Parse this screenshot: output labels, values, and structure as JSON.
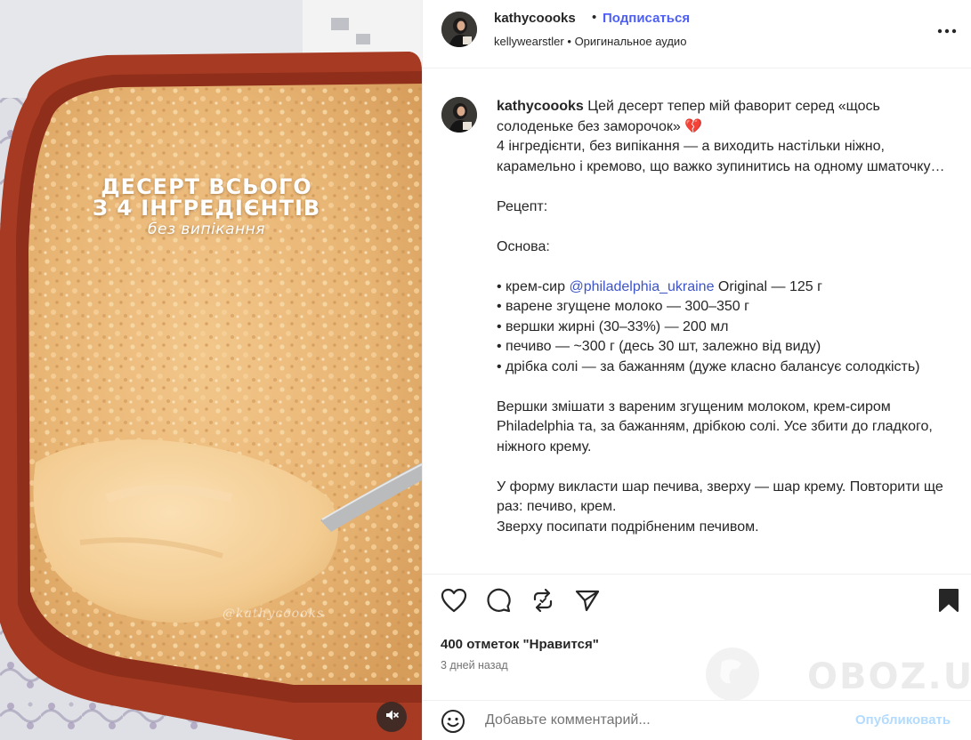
{
  "post": {
    "media": {
      "overlay_line1": "ДЕСЕРТ ВСЬОГО",
      "overlay_line2": "З 4 ІНГРЕДІЄНТІВ",
      "overlay_sub": "без випікання",
      "watermark": "@kathycoooks",
      "mute_icon": "speaker-muted-icon"
    },
    "header": {
      "username": "kathycoooks",
      "separator": "•",
      "follow_label": "Подписаться",
      "audio_user": "kellywearstler",
      "audio_separator": "•",
      "audio_label": "Оригинальное аудио",
      "more_icon": "more-options-icon"
    },
    "caption": {
      "username": "kathycoooks",
      "first_line": "Цей десерт тепер мій фаворит серед «щось солоденьке без заморочок» 💔",
      "lines": [
        "4 інгредієнти, без випікання — а виходить настільки ніжно, карамельно і кремово, що важко зупинитись на одному шматочку…",
        "",
        "Рецепт:",
        "",
        "Основа:",
        ""
      ],
      "ingredient_mention_prefix": "• крем-сир ",
      "ingredient_mention": "@philadelphia_ukraine",
      "ingredient_mention_suffix": " Original — 125 г",
      "ingredients": [
        "• варене згущене молоко — 300–350 г",
        "• вершки жирні (30–33%) — 200 мл",
        "• печиво — ~300 г (десь 30 шт, залежно від виду)",
        "• дрібка солі — за бажанням (дуже класно балансує солодкість)"
      ],
      "steps": [
        "",
        "Вершки змішати з вареним згущеним молоком, крем-сиром Philadelphia та, за бажанням, дрібкою солі. Усе збити до гладкого, ніжного крему.",
        "",
        "У форму викласти шар печива, зверху — шар крему. Повторити ще раз: печиво, крем.",
        "Зверху посипати подрібненим печивом."
      ]
    },
    "actions": {
      "like_icon": "heart-icon",
      "comment_icon": "comment-bubble-icon",
      "repost_icon": "repost-icon",
      "share_icon": "paper-plane-icon",
      "save_icon": "bookmark-filled-icon",
      "likes_text": "400 отметок \"Нравится\"",
      "time_ago": "3 дней назад"
    },
    "comment": {
      "emoji_icon": "smiley-icon",
      "placeholder": "Добавьте комментарий...",
      "publish_label": "Опубликовать"
    },
    "watermark_site": "OBOZ.UA"
  },
  "colors": {
    "link_blue": "#4e5ff5",
    "mention_blue": "#3d54c7",
    "publish_disabled": "#b3dbff",
    "text": "#262626",
    "muted": "#737373"
  }
}
